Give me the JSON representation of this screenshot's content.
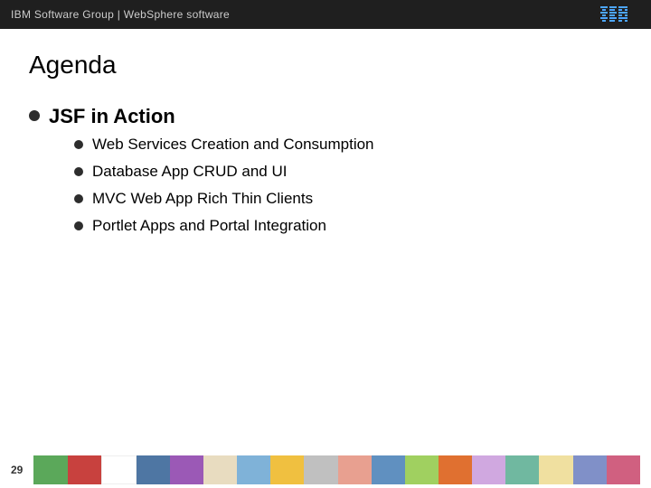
{
  "header": {
    "title": "IBM Software Group  |  WebSphere software",
    "ibm_label": "IBM"
  },
  "page": {
    "title": "Agenda",
    "sections": [
      {
        "id": "jsf-in-action",
        "label": "JSF in Action",
        "items": [
          {
            "id": "item-1",
            "label": "Web Services Creation and Consumption"
          },
          {
            "id": "item-2",
            "label": "Database App CRUD and UI"
          },
          {
            "id": "item-3",
            "label": "MVC Web App Rich Thin Clients"
          },
          {
            "id": "item-4",
            "label": "Portlet Apps and Portal Integration"
          }
        ]
      }
    ]
  },
  "footer": {
    "page_number": "29"
  }
}
